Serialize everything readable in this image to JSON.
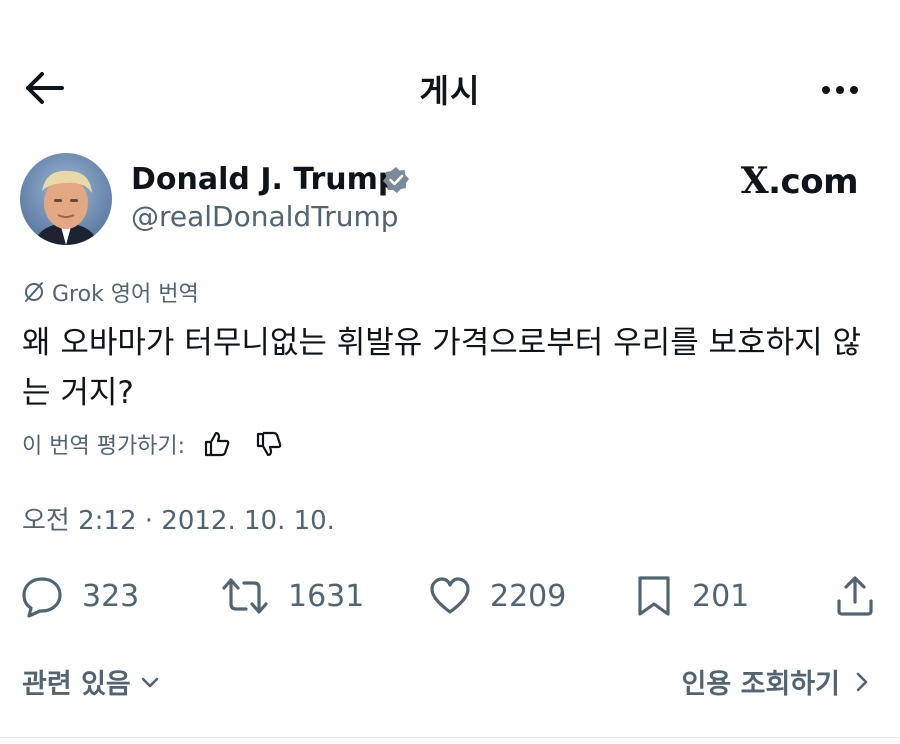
{
  "header": {
    "title": "게시"
  },
  "author": {
    "display_name": "Donald J. Trump",
    "handle": "@realDonaldTrump",
    "verified_color": "#7a8a99"
  },
  "watermark": {
    "x": "X",
    "rest": ".com"
  },
  "translation": {
    "label": "Grok 영어 번역",
    "text": "왜 오바마가 터무니없는 휘발유 가격으로부터 우리를 보호하지 않는 거지?",
    "rate_label": "이 번역 평가하기:"
  },
  "timestamp": "오전 2:12 · 2012. 10. 10.",
  "actions": {
    "reply": "323",
    "retweet": "1631",
    "like": "2209",
    "bookmark": "201"
  },
  "footer": {
    "related": "관련 있음",
    "quotes": "인용 조회하기"
  },
  "colors": {
    "text": "#0f1419",
    "secondary": "#536471"
  }
}
